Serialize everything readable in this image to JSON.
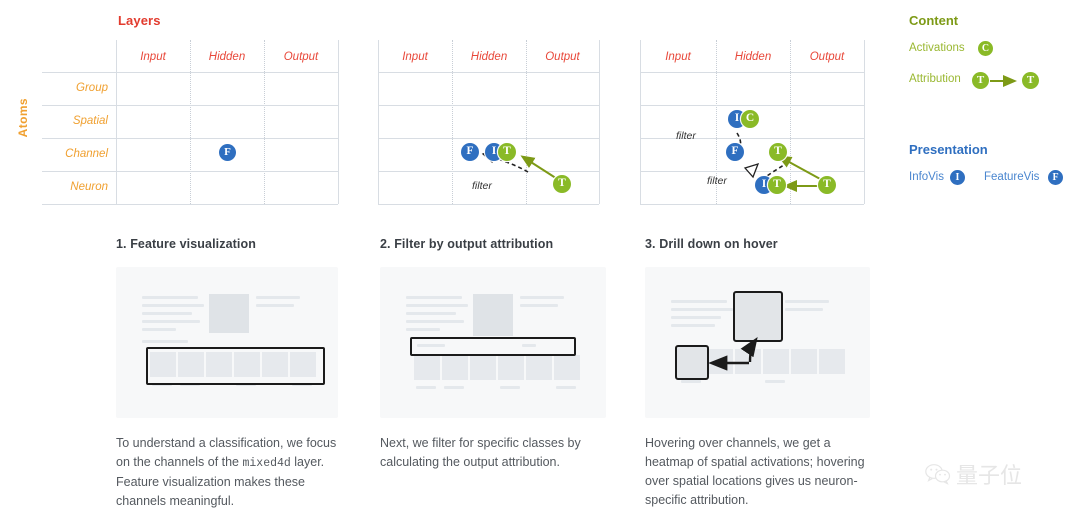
{
  "matrices": {
    "title": "Layers",
    "axis_label": "Atoms",
    "columns": [
      "Input",
      "Hidden",
      "Output"
    ],
    "rows": [
      "Group",
      "Spatial",
      "Channel",
      "Neuron"
    ],
    "filter_label": "filter",
    "panels": [
      {
        "id": "matrix-1",
        "badges": [
          {
            "letter": "F",
            "color": "blue",
            "row": "Channel",
            "col": "Hidden"
          }
        ],
        "filters": [],
        "arrows": []
      },
      {
        "id": "matrix-2",
        "badges": [
          {
            "letter": "F",
            "color": "blue",
            "row": "Channel",
            "col": "Hidden"
          },
          {
            "letter": "I",
            "color": "blue",
            "row": "Channel",
            "col": "Hidden"
          },
          {
            "letter": "T",
            "color": "green",
            "row": "Channel",
            "col": "Hidden"
          },
          {
            "letter": "T",
            "color": "green",
            "row": "Neuron",
            "col": "Output"
          }
        ],
        "filters": [
          "filter"
        ],
        "arrows": [
          "output-attribution-to-hidden-channel"
        ]
      },
      {
        "id": "matrix-3",
        "badges": [
          {
            "letter": "I",
            "color": "blue",
            "row": "Spatial",
            "col": "Hidden"
          },
          {
            "letter": "C",
            "color": "green",
            "row": "Spatial",
            "col": "Hidden"
          },
          {
            "letter": "F",
            "color": "blue",
            "row": "Channel",
            "col": "Hidden"
          },
          {
            "letter": "T",
            "color": "green",
            "row": "Channel",
            "col": "Hidden"
          },
          {
            "letter": "I",
            "color": "blue",
            "row": "Neuron",
            "col": "Hidden"
          },
          {
            "letter": "T",
            "color": "green",
            "row": "Neuron",
            "col": "Hidden"
          },
          {
            "letter": "T",
            "color": "green",
            "row": "Neuron",
            "col": "Output"
          }
        ],
        "filters": [
          "filter",
          "filter"
        ],
        "arrows": [
          "attribution-to-channel",
          "attribution-to-neuron"
        ]
      }
    ]
  },
  "legend": {
    "content": {
      "heading": "Content",
      "items": [
        {
          "label": "Activations",
          "badge": "C",
          "color": "green"
        },
        {
          "label": "Attribution",
          "badge": "T",
          "color": "green",
          "second_badge": "T",
          "arrow": true
        }
      ]
    },
    "presentation": {
      "heading": "Presentation",
      "items": [
        {
          "label": "InfoVis",
          "badge": "I",
          "color": "blue"
        },
        {
          "label": "FeatureVis",
          "badge": "F",
          "color": "blue"
        }
      ]
    }
  },
  "steps": [
    {
      "title": "1. Feature visualization",
      "body_pre": "To understand a classification, we focus on the channels of the ",
      "body_mono": "mixed4d",
      "body_post": " layer. Feature visualization makes these channels meaningful.",
      "highlight": "thumbnail-row"
    },
    {
      "title": "2. Filter by output attribution",
      "body_pre": "Next, we filter for specific classes by calculating the output attribution.",
      "body_mono": "",
      "body_post": "",
      "highlight": "filter-bar"
    },
    {
      "title": "3. Drill down on hover",
      "body_pre": "Hovering over channels, we get a heatmap of spatial activations; hovering over spatial locations gives us neuron-specific attribution.",
      "body_mono": "",
      "body_post": "",
      "highlight": "zoom-detail"
    }
  ],
  "watermark": {
    "icon": "wechat-icon",
    "text": "量子位"
  },
  "colors": {
    "accent_red": "#e23b2e",
    "accent_orange": "#f0a030",
    "badge_blue": "#2f6fc0",
    "badge_green": "#8aba27",
    "content_heading": "#7d9a16",
    "presentation_heading": "#2f6fc0"
  }
}
